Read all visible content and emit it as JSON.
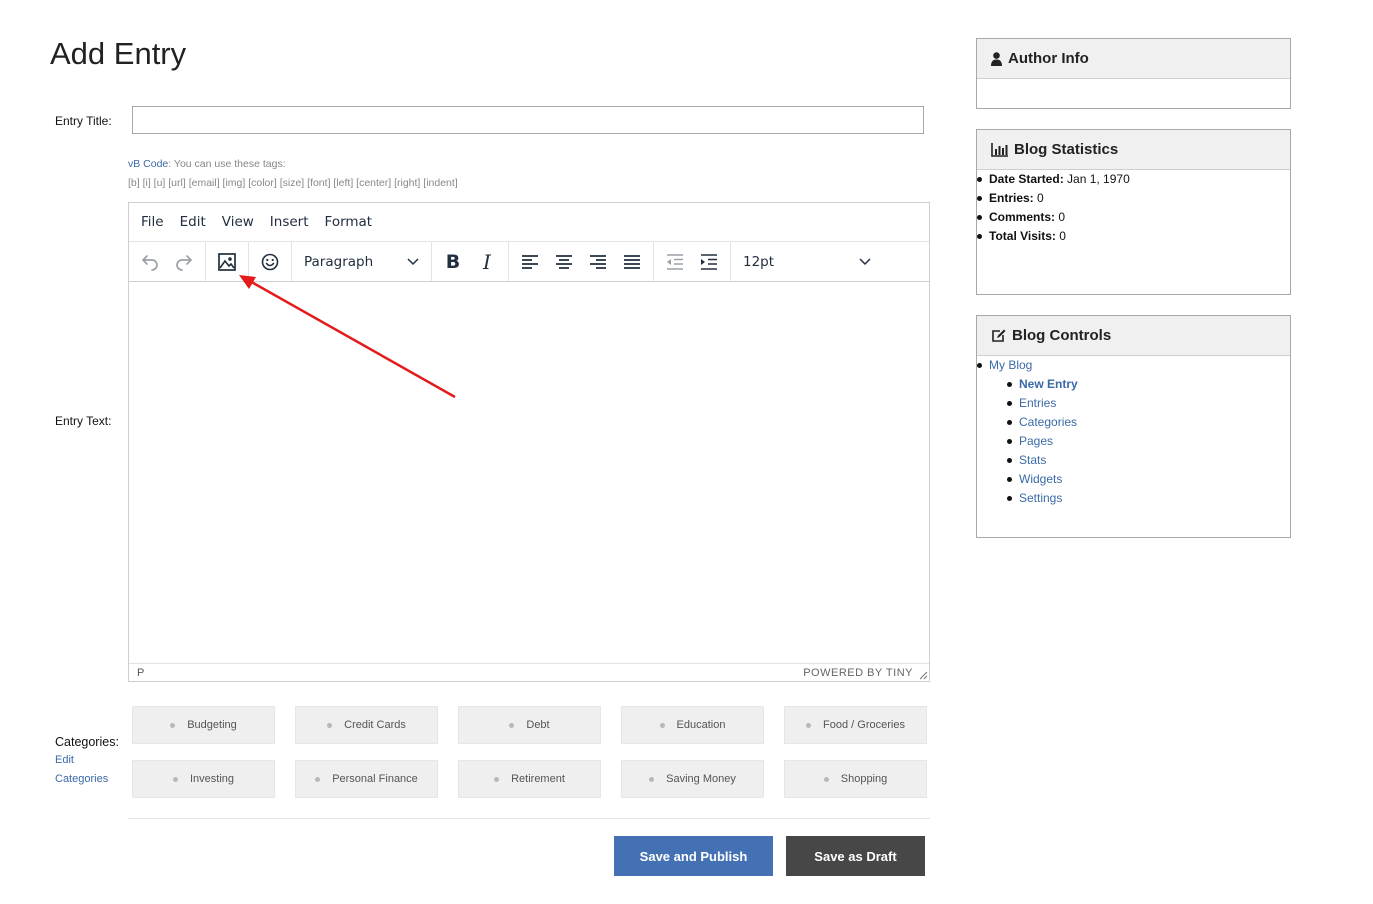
{
  "page": {
    "title": "Add Entry",
    "entry_title_label": "Entry Title:",
    "entry_title_value": "",
    "entry_text_label": "Entry Text:"
  },
  "vb_help": {
    "link": "vB Code",
    "text": ": You can use these tags:",
    "tags": "[b] [i] [u] [url] [email] [img] [color] [size] [font] [left] [center] [right] [indent]"
  },
  "editor": {
    "menu": [
      "File",
      "Edit",
      "View",
      "Insert",
      "Format"
    ],
    "block_format": "Paragraph",
    "font_size": "12pt",
    "status_path": "P",
    "powered_by": "POWERED BY TINY",
    "icons": {
      "undo": "undo-icon",
      "redo": "redo-icon",
      "image": "image-icon",
      "emoticons": "emoticons-icon",
      "bold": "B",
      "italic": "I",
      "align_left": "align-left-icon",
      "align_center": "align-center-icon",
      "align_right": "align-right-icon",
      "align_justify": "align-justify-icon",
      "outdent": "outdent-icon",
      "indent": "indent-icon"
    }
  },
  "categories": {
    "label": "Categories:",
    "edit_link": "Edit",
    "edit_link2": "Categories",
    "items": [
      "Budgeting",
      "Credit Cards",
      "Debt",
      "Education",
      "Food / Groceries",
      "Investing",
      "Personal Finance",
      "Retirement",
      "Saving Money",
      "Shopping"
    ]
  },
  "actions": {
    "publish": "Save and Publish",
    "draft": "Save as Draft"
  },
  "sidebar": {
    "author_info": {
      "title": "Author Info"
    },
    "blog_stats": {
      "title": "Blog Statistics",
      "items": [
        {
          "label": "Date Started:",
          "value": "Jan 1, 1970"
        },
        {
          "label": "Entries:",
          "value": "0"
        },
        {
          "label": "Comments:",
          "value": "0"
        },
        {
          "label": "Total Visits:",
          "value": "0"
        }
      ]
    },
    "blog_controls": {
      "title": "Blog Controls",
      "root": "My Blog",
      "items": [
        "New Entry",
        "Entries",
        "Categories",
        "Pages",
        "Stats",
        "Widgets",
        "Settings"
      ]
    }
  },
  "colors": {
    "link": "#3b6aa8",
    "publish_button": "#4471b4",
    "draft_button": "#474747",
    "annotation_arrow": "#e31b1b"
  }
}
